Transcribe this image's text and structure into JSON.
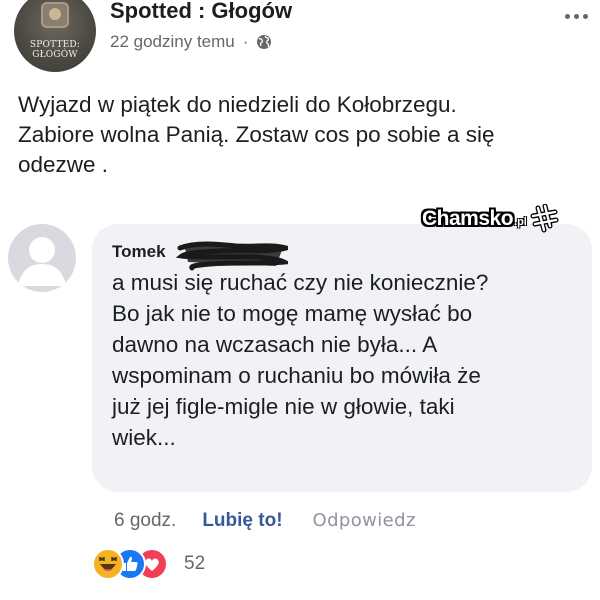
{
  "post": {
    "page_name": "Spotted : Głogów",
    "avatar_text": "SPOTTED: GŁOGÓW",
    "time": "22 godziny temu",
    "separator": "·",
    "privacy_icon": "globe-icon",
    "more_icon": "more-options-icon",
    "text": "Wyjazd w piątek do niedzieli do Kołobrzegu.\nZabiore wolna Panią.  Zostaw cos po sobie a się\nodezwe ."
  },
  "watermark": {
    "text": "Chamsko",
    "suffix": ".pl"
  },
  "comment": {
    "author": "Tomek",
    "text": "a musi się ruchać czy nie koniecznie?\nBo jak nie to mogę mamę wysłać bo\ndawno na wczasach nie była... A\nwspominam o ruchaniu bo mówiła że\njuż jej figle-migle nie w głowie, taki\nwiek...",
    "actions": {
      "time": "6 godz.",
      "like": "Lubię to!",
      "reply": "Odpowiedz"
    },
    "reactions": {
      "icons": [
        "haha-reaction-icon",
        "like-reaction-icon",
        "love-reaction-icon"
      ],
      "count": "52"
    }
  },
  "colors": {
    "bubble": "#f0f2f5",
    "link": "#385898",
    "muted": "#65676b",
    "like_blue": "#1877f2",
    "love_red": "#f33e58",
    "haha_yellow": "#f7b125"
  }
}
